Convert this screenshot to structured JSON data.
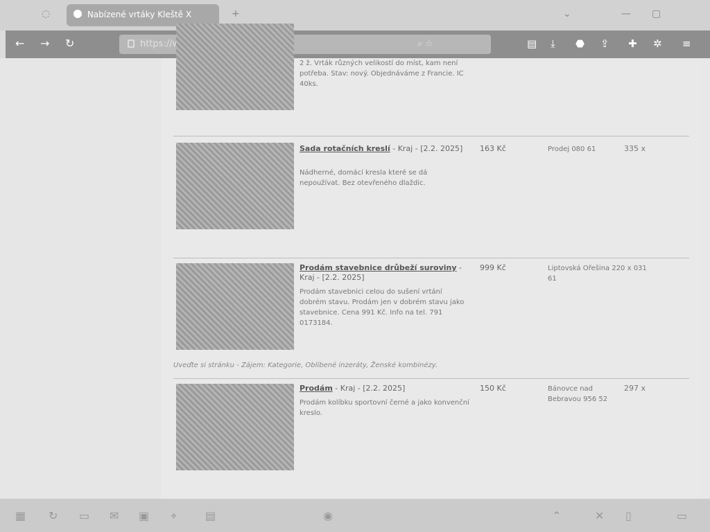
{
  "browser": {
    "tab_title": "Nabízené vrtáky Kleště X",
    "tab_controls": {
      "menu": "⌄",
      "minimize": "—",
      "maximize": "▢",
      "new_tab": "+"
    },
    "url": "https://www.sbazar.cz/hledat",
    "url_suffix": "⌕ ☆"
  },
  "listings": [
    {
      "title": "",
      "meta": "",
      "desc": "2 ž. Vrták různých velikostí do míst, kam není potřeba. Stav: nový. Objednáváme z Francie. IC 40ks.",
      "price": "",
      "location": "",
      "views": ""
    },
    {
      "title": "Sada rotačních kreslí",
      "meta": " - Kraj - [2.2. 2025]",
      "desc": "Nádherné, domácí kresla které se dá nepoužívat. Bez otevřeného dlaždic.",
      "price": "163 Kč",
      "location": "Prodej 080 61",
      "views": "335 x"
    },
    {
      "title": "Prodám stavebnice drůbeží suroviny",
      "meta": " - Kraj - [2.2. 2025]",
      "desc": "Prodám stavebnici celou do sušení vrtání dobrém stavu. Prodám jen v dobrém stavu jako stavebnice. Cena 991 Kč. Info na tel. 791 0173184.",
      "price": "999 Kč",
      "location": "Liptovská Ořešina 220 x 031 61",
      "views": "",
      "extra": "Uveďte si stránku - Zájem: Kategorie, Oblíbené inzeráty, Ženské kombinézy."
    },
    {
      "title": "Prodám",
      "meta": " - Kraj - [2.2. 2025]",
      "desc": "Prodám kolíbku sportovní černé a jako konvenční kreslo.",
      "price": "150 Kč",
      "location": "Bánovce nad Bebravou 956 52",
      "views": "297 x"
    }
  ]
}
